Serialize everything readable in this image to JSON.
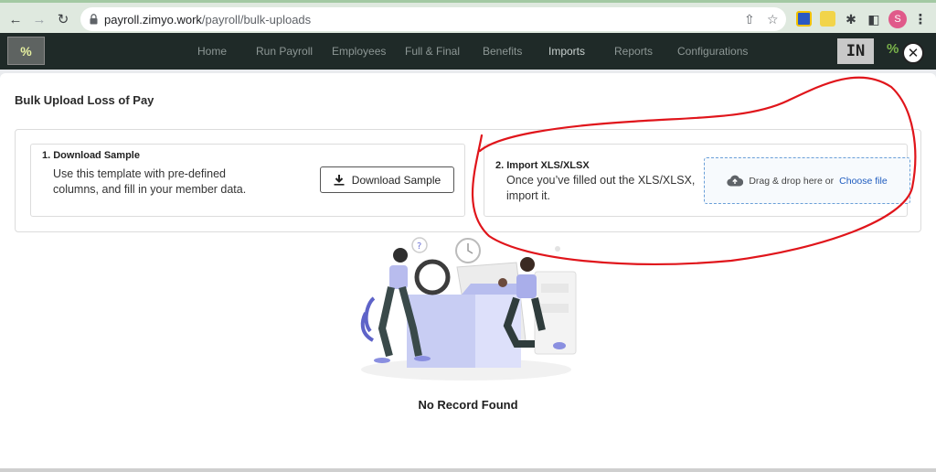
{
  "browser": {
    "url_host": "payroll.zimyo.work",
    "url_path": "/payroll/bulk-uploads",
    "profile_initial": "S",
    "icons": [
      "back-icon",
      "forward-icon",
      "reload-icon",
      "lock-icon",
      "share-icon",
      "star-icon",
      "extension-icon",
      "puzzle-icon",
      "sidebar-icon",
      "kebab-menu-icon"
    ]
  },
  "header": {
    "nav": [
      "Home",
      "Run Payroll",
      "Employees",
      "Full & Final",
      "Benefits",
      "Imports",
      "Reports",
      "Configurations"
    ],
    "active": "Imports",
    "country_badge": "IN"
  },
  "modal": {
    "title": "Bulk Upload Loss of Pay",
    "download": {
      "heading": "1. Download Sample",
      "description": "Use this template with pre-defined columns, and fill in your member data.",
      "button_label": "Download Sample"
    },
    "import": {
      "heading": "2. Import XLS/XLSX",
      "description": "Once you’ve filled out the XLS/XLSX, import it.",
      "drop_text": "Drag & drop here or",
      "choose_file": "Choose file"
    },
    "empty_text": "No Record Found"
  },
  "colors": {
    "header_bg": "#1f2a28",
    "annotation": "#e0151b",
    "link": "#1e5bbf"
  }
}
